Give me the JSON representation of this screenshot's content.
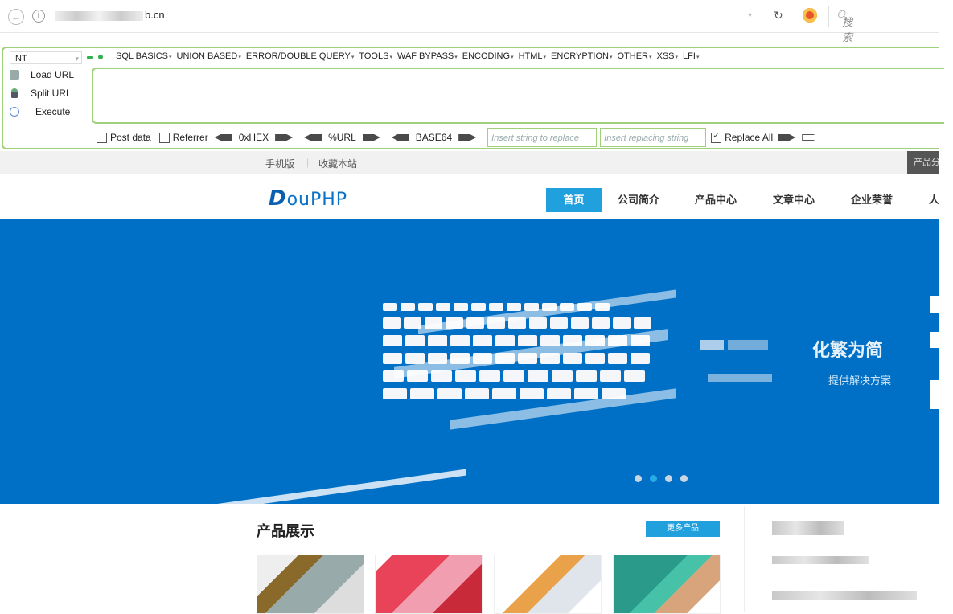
{
  "browser": {
    "url_suffix": "b.cn",
    "search_placeholder": "搜索"
  },
  "hackbar": {
    "select_value": "INT",
    "menus": [
      "SQL BASICS",
      "UNION BASED",
      "ERROR/DOUBLE QUERY",
      "TOOLS",
      "WAF BYPASS",
      "ENCODING",
      "HTML",
      "ENCRYPTION",
      "OTHER",
      "XSS",
      "LFI"
    ],
    "load_url": "Load URL",
    "split_url": "Split URL",
    "execute": "Execute",
    "post_data": "Post data",
    "referrer": "Referrer",
    "hex": "0xHEX",
    "url_enc": "%URL",
    "base64": "BASE64",
    "find_placeholder": "Insert string to replace",
    "replace_placeholder": "Insert replacing string",
    "replace_all": "Replace All"
  },
  "site": {
    "top_links": [
      "手机版",
      "收藏本站"
    ],
    "top_right": "产品分类",
    "logo_rest": "ouPHP",
    "logo_d": "D",
    "nav": [
      "首页",
      "公司简介",
      "产品中心",
      "文章中心",
      "企业荣誉",
      "人"
    ],
    "banner_title": "化繁为简",
    "banner_sub": "提供解决方案",
    "products_title": "产品展示",
    "more_products": "更多产品"
  },
  "colors": {
    "brand_blue": "#0070c6",
    "accent": "#21a0de",
    "hackbar_green": "#9fd07a"
  }
}
